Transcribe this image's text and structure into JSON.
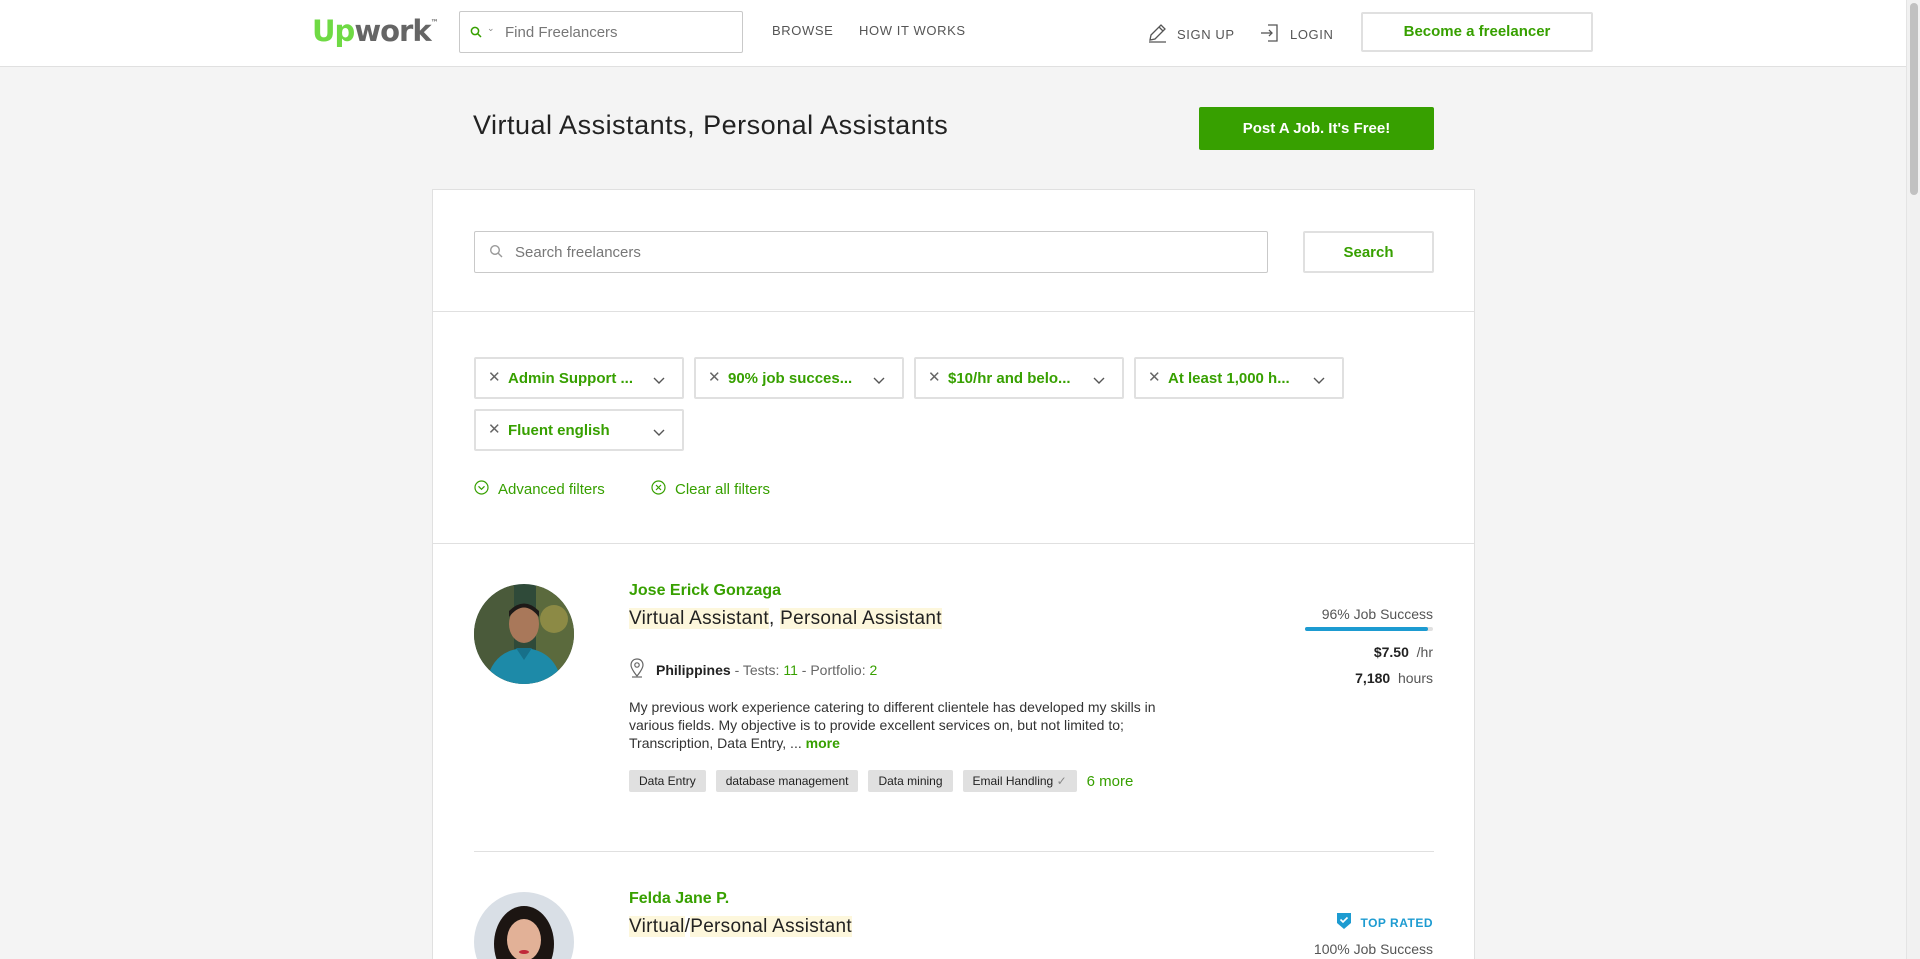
{
  "header": {
    "logo_up": "Up",
    "logo_work": "work",
    "logo_tm": "™",
    "search_placeholder": "Find Freelancers",
    "nav": [
      "BROWSE",
      "HOW IT WORKS"
    ],
    "signup_label": "SIGN UP",
    "login_label": "LOGIN",
    "become_label": "Become a freelancer"
  },
  "page": {
    "title": "Virtual Assistants, Personal Assistants",
    "post_job_label": "Post A Job. It's Free!"
  },
  "search": {
    "placeholder": "Search freelancers",
    "button_label": "Search"
  },
  "filters": {
    "chips": [
      "Admin Support ...",
      "90% job succes...",
      "$10/hr and belo...",
      "At least 1,000 h...",
      "Fluent english"
    ],
    "advanced_label": "Advanced filters",
    "clear_label": "Clear all filters"
  },
  "freelancers": [
    {
      "name": "Jose Erick Gonzaga",
      "title_part1": "Virtual Assistant",
      "title_sep": ", ",
      "title_part2": "Personal Assistant",
      "country": "Philippines",
      "tests_label": " - Tests: ",
      "tests": "11",
      "portfolio_label": " - Portfolio: ",
      "portfolio": "2",
      "description": "My previous work experience catering to different clientele has developed my skills in various fields. My objective is to provide excellent services on, but not limited to; Transcription, Data Entry, ... ",
      "more_label": "more",
      "skills": [
        "Data Entry",
        "database management",
        "Data mining",
        "Email Handling"
      ],
      "skills_more": "6 more",
      "job_success": "96% Job Success",
      "job_success_value": 0.96,
      "rate": "$7.50",
      "rate_unit": "/hr",
      "hours": "7,180",
      "hours_unit": "hours"
    },
    {
      "name": "Felda Jane P.",
      "title_part1": "Virtual",
      "title_sep": "/",
      "title_part2": "Personal Assistant",
      "badge": "TOP RATED",
      "job_success": "100% Job Success"
    }
  ],
  "colors": {
    "brand_green": "#37a000",
    "logo_green": "#6fda44",
    "job_bar_blue": "#1d9bd1",
    "top_rated_blue": "#1d9bd1"
  }
}
